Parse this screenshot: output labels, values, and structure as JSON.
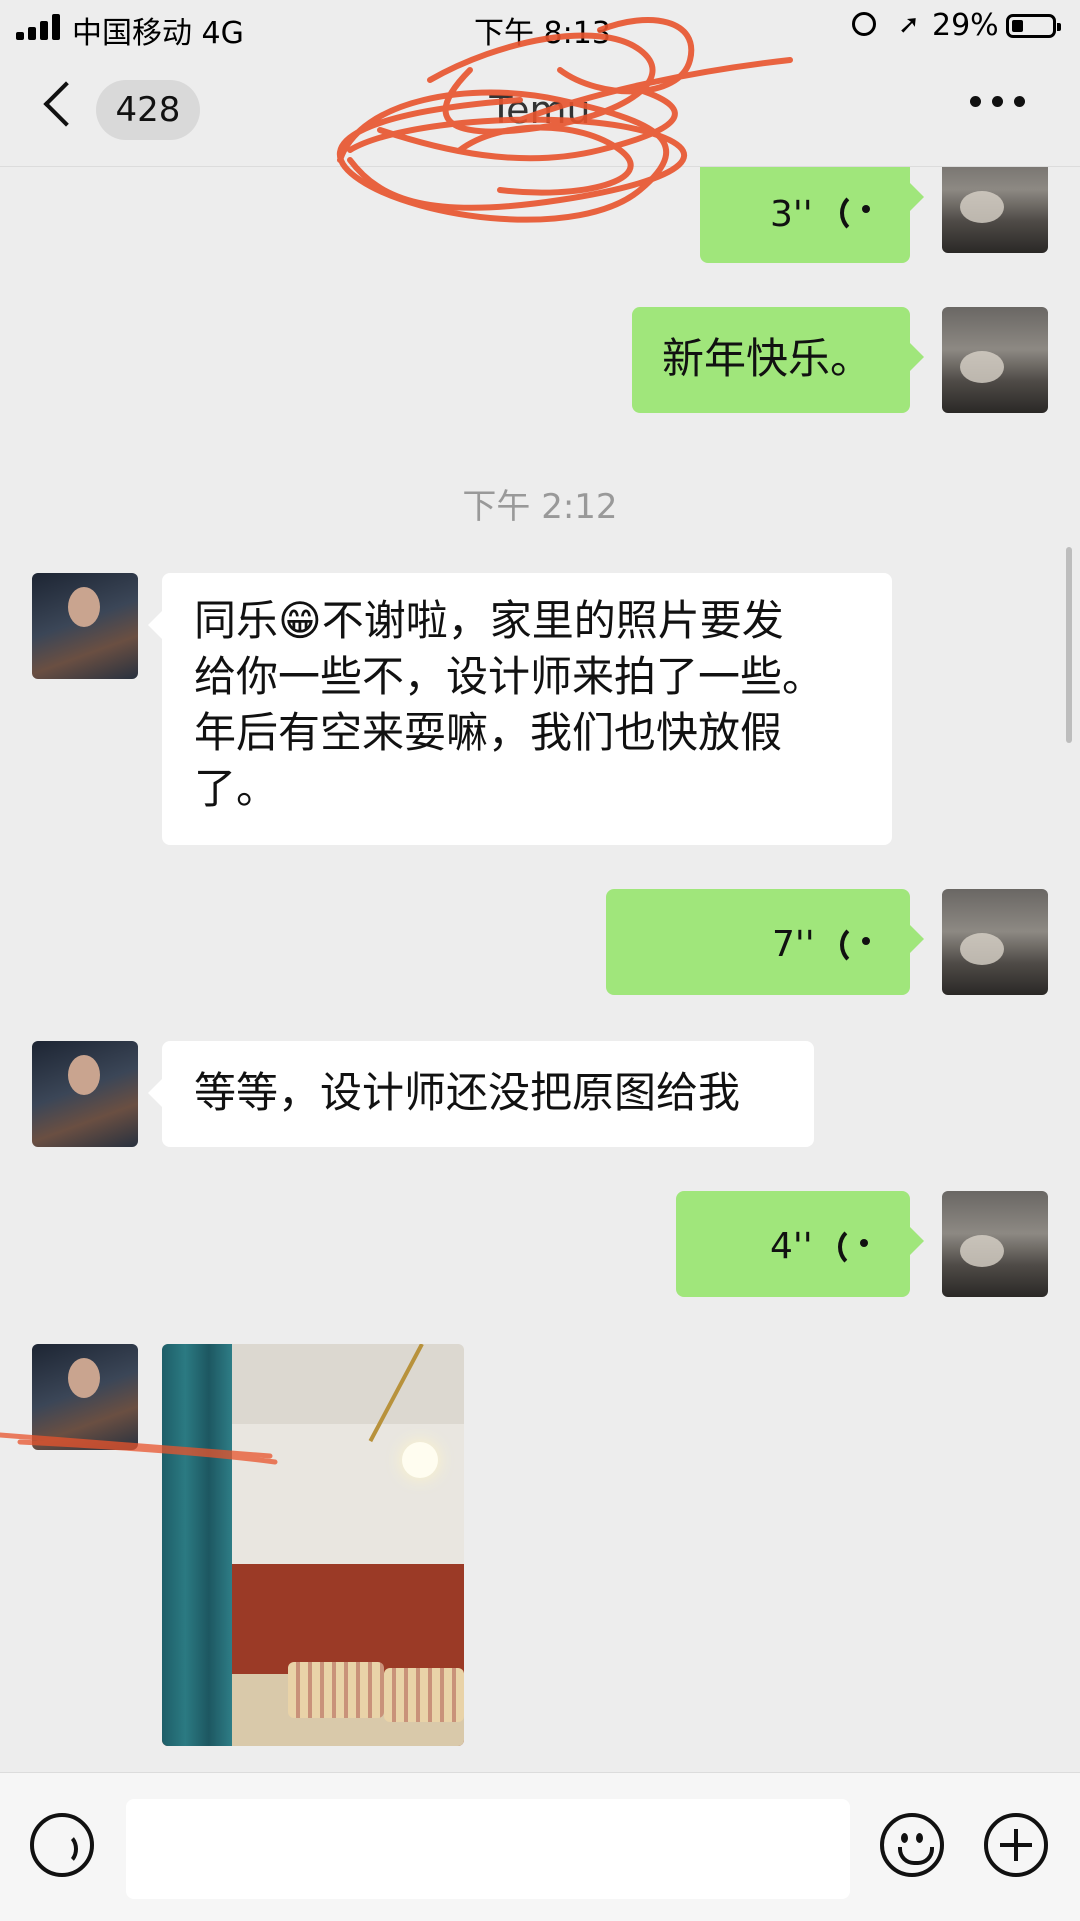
{
  "status_bar": {
    "carrier": "中国移动 4G",
    "time": "下午 8:13",
    "battery": "29%"
  },
  "nav": {
    "unread_count": "428",
    "title": "Temu"
  },
  "messages": [
    {
      "side": "right",
      "type": "voice",
      "duration": "3''"
    },
    {
      "side": "right",
      "type": "text",
      "text": "新年快乐。"
    },
    {
      "type": "timestamp",
      "text": "下午 2:12"
    },
    {
      "side": "left",
      "type": "text",
      "lines": [
        "同乐😁不谢啦，家里的照片要发",
        "给你一些不，设计师来拍了一些。",
        "年后有空来耍嘛，我们也快放假",
        "了。"
      ]
    },
    {
      "side": "right",
      "type": "voice",
      "duration": "7''"
    },
    {
      "side": "left",
      "type": "text",
      "text": "等等，设计师还没把原图给我"
    },
    {
      "side": "right",
      "type": "voice",
      "duration": "4''"
    },
    {
      "side": "left",
      "type": "image"
    }
  ],
  "colors": {
    "bubble_self": "#a0e67b",
    "bubble_other": "#ffffff",
    "background": "#ededed",
    "scribble": "#e8542d"
  },
  "icons": [
    "back-chevron-icon",
    "more-dots-icon",
    "voice-wave-icon",
    "voice-input-icon",
    "emoji-icon",
    "plus-icon"
  ]
}
